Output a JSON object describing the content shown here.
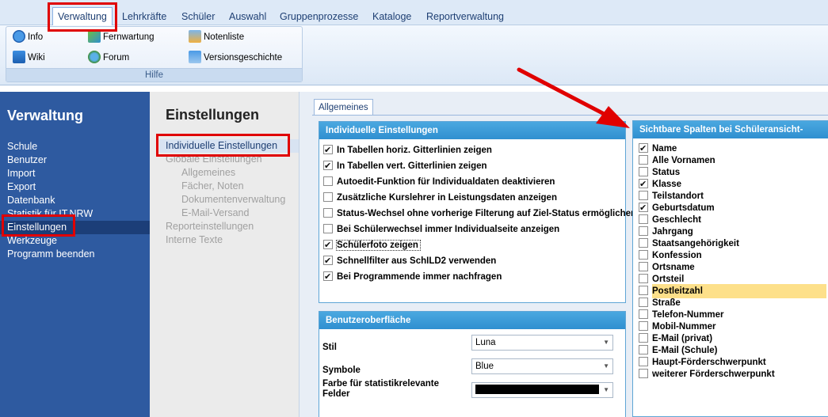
{
  "ribbon": {
    "tabs": [
      "Verwaltung",
      "Lehrkräfte",
      "Schüler",
      "Auswahl",
      "Gruppenprozesse",
      "Kataloge",
      "Reportverwaltung"
    ],
    "group_label": "Hilfe",
    "items": {
      "info": "Info",
      "fernwartung": "Fernwartung",
      "notenliste": "Notenliste",
      "wiki": "Wiki",
      "forum": "Forum",
      "versionsgeschichte": "Versionsgeschichte"
    }
  },
  "leftnav": {
    "title": "Verwaltung",
    "items": [
      "Schule",
      "Benutzer",
      "Import",
      "Export",
      "Datenbank",
      "Statistik für IT.NRW",
      "Einstellungen",
      "Werkzeuge",
      "Programm beenden"
    ]
  },
  "submenu": {
    "title": "Einstellungen",
    "items": [
      "Individuelle Einstellungen",
      "Globale Einstellungen",
      "Allgemeines",
      "Fächer, Noten",
      "Dokumentenverwaltung",
      "E-Mail-Versand",
      "Reporteinstellungen",
      "Interne Texte"
    ]
  },
  "content": {
    "tab": "Allgemeines",
    "individuelle": {
      "title": "Individuelle Einstellungen",
      "options": [
        {
          "label": "In Tabellen horiz. Gitterlinien zeigen",
          "checked": true
        },
        {
          "label": "In Tabellen vert. Gitterlinien zeigen",
          "checked": true
        },
        {
          "label": "Autoedit-Funktion für Individualdaten deaktivieren",
          "checked": false
        },
        {
          "label": "Zusätzliche Kurslehrer in Leistungsdaten anzeigen",
          "checked": false
        },
        {
          "label": "Status-Wechsel ohne vorherige Filterung auf Ziel-Status ermöglichen",
          "checked": false
        },
        {
          "label": "Bei Schülerwechsel immer Individualseite anzeigen",
          "checked": false
        },
        {
          "label": "Schülerfoto zeigen",
          "checked": true
        },
        {
          "label": "Schnellfilter aus SchILD2 verwenden",
          "checked": true
        },
        {
          "label": "Bei Programmende immer nachfragen",
          "checked": true
        }
      ]
    },
    "oberflaeche": {
      "title": "Benutzeroberfläche",
      "stil_label": "Stil",
      "stil_value": "Luna",
      "symbole_label": "Symbole",
      "symbole_value": "Blue",
      "farbe_label": "Farbe für statistikrelevante Felder"
    },
    "spalten": {
      "title": "Sichtbare Spalten bei Schüleransicht-Tabelle",
      "columns": [
        {
          "label": "Name",
          "checked": true
        },
        {
          "label": "Alle Vornamen",
          "checked": false
        },
        {
          "label": "Status",
          "checked": false
        },
        {
          "label": "Klasse",
          "checked": true
        },
        {
          "label": "Teilstandort",
          "checked": false
        },
        {
          "label": "Geburtsdatum",
          "checked": true
        },
        {
          "label": "Geschlecht",
          "checked": false
        },
        {
          "label": "Jahrgang",
          "checked": false
        },
        {
          "label": "Staatsangehörigkeit",
          "checked": false
        },
        {
          "label": "Konfession",
          "checked": false
        },
        {
          "label": "Ortsname",
          "checked": false
        },
        {
          "label": "Ortsteil",
          "checked": false
        },
        {
          "label": "Postleitzahl",
          "checked": false
        },
        {
          "label": "Straße",
          "checked": false
        },
        {
          "label": "Telefon-Nummer",
          "checked": false
        },
        {
          "label": "Mobil-Nummer",
          "checked": false
        },
        {
          "label": "E-Mail (privat)",
          "checked": false
        },
        {
          "label": "E-Mail (Schule)",
          "checked": false
        },
        {
          "label": "Haupt-Förderschwerpunkt",
          "checked": false
        },
        {
          "label": "weiterer Förderschwerpunkt",
          "checked": false
        }
      ]
    }
  },
  "colors": {
    "nav_bg": "#2e5aa0",
    "panel_header": "#3a9bd8",
    "highlight": "#fde08a",
    "annotation": "#e00000"
  }
}
